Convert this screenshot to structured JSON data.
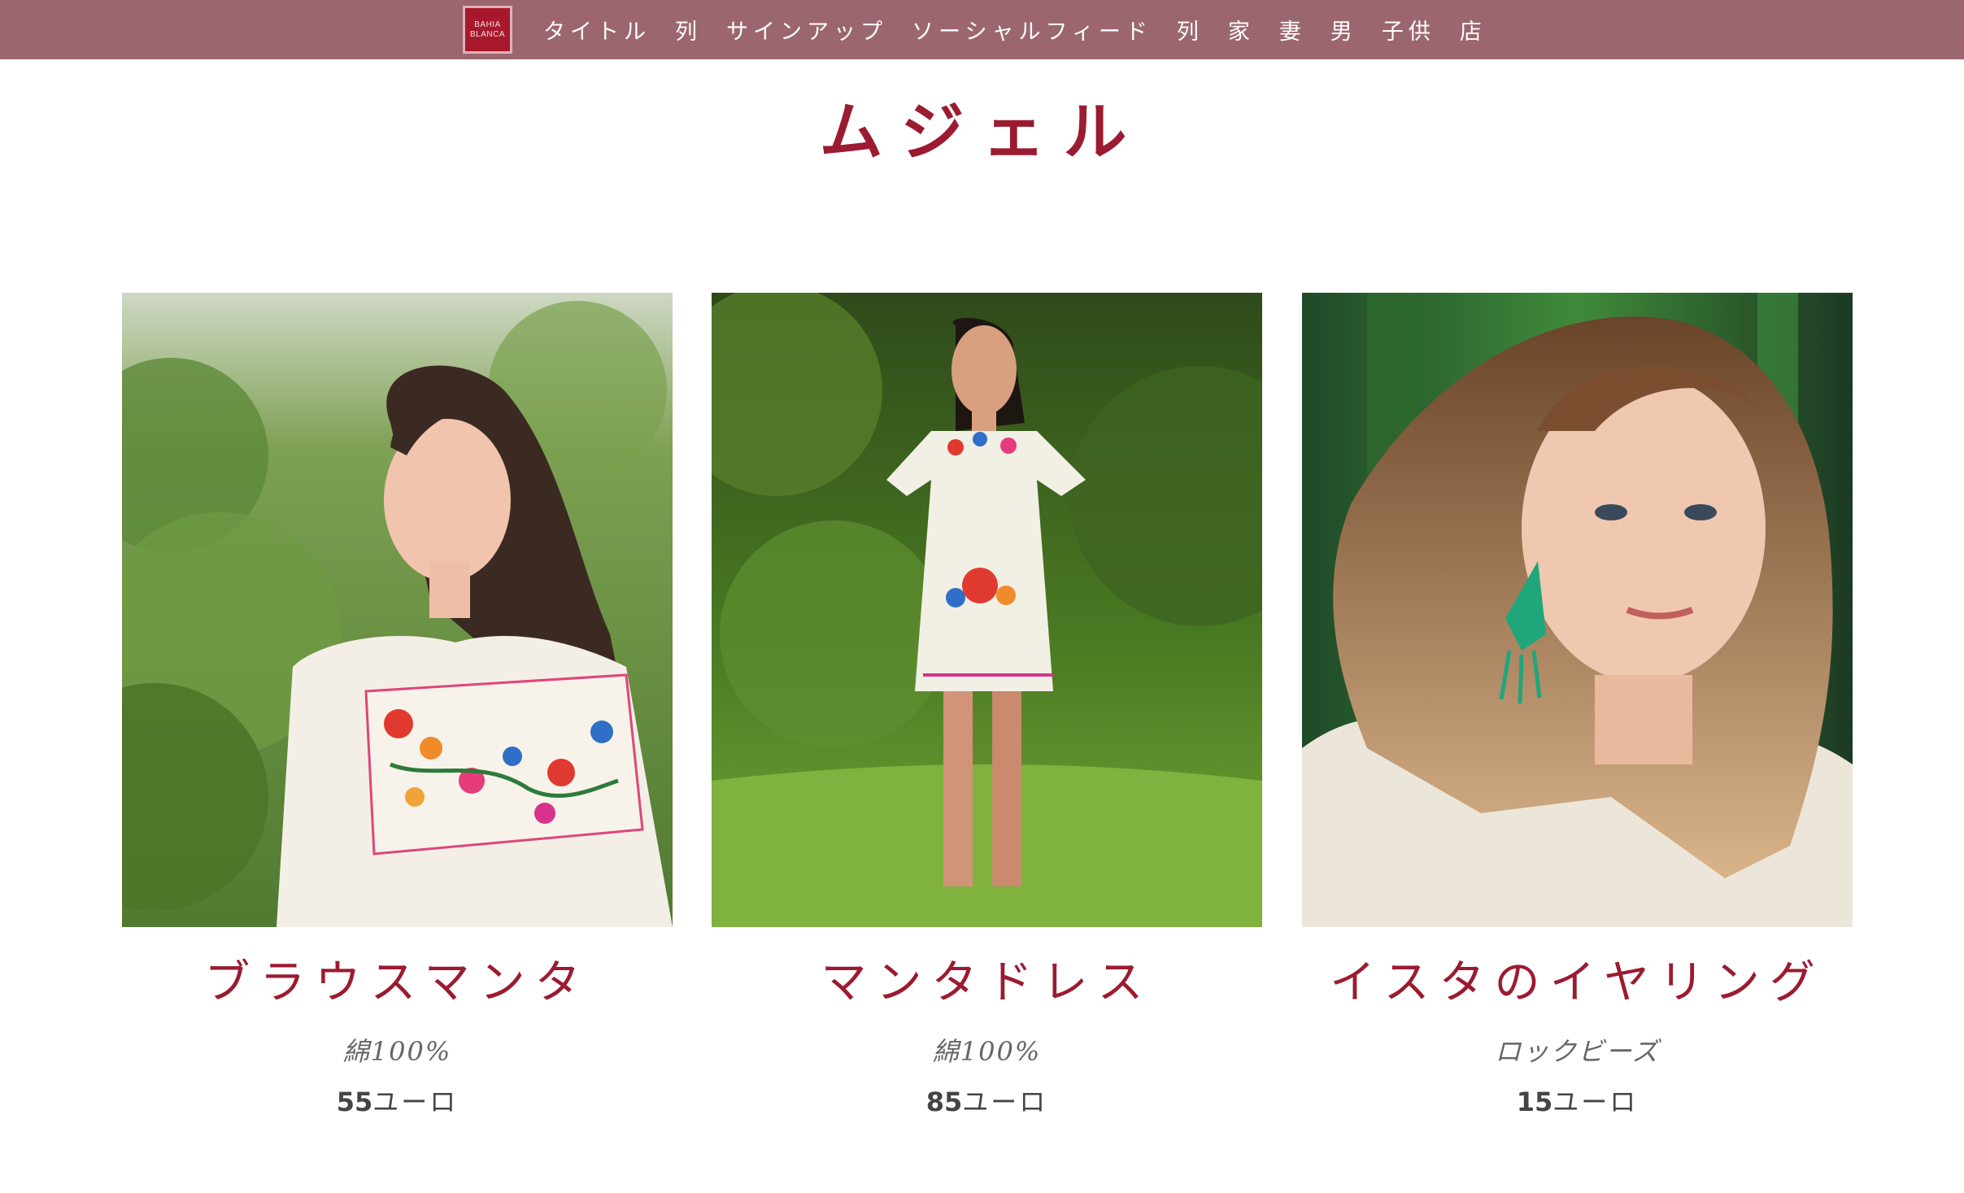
{
  "nav": {
    "logo_line1": "BAHIA",
    "logo_line2": "BLANCA",
    "links": [
      "タイトル",
      "列",
      "サインアップ",
      "ソーシャルフィード",
      "列",
      "家",
      "妻",
      "男",
      "子供",
      "店"
    ]
  },
  "page": {
    "title": "ムジェル"
  },
  "products": [
    {
      "name": "ブラウスマンタ",
      "material": "綿100%",
      "price": "55",
      "currency": "ユーロ",
      "image": "woman-embroidered-blouse-photo"
    },
    {
      "name": "マンタドレス",
      "material": "綿100%",
      "price": "85",
      "currency": "ユーロ",
      "image": "woman-embroidered-dress-photo"
    },
    {
      "name": "イスタのイヤリング",
      "material": "ロックビーズ",
      "price": "15",
      "currency": "ユーロ",
      "image": "woman-beaded-earring-photo"
    }
  ],
  "colors": {
    "navbar": "#9b6670",
    "accent": "#9b1b30",
    "logo": "#a8182c"
  }
}
